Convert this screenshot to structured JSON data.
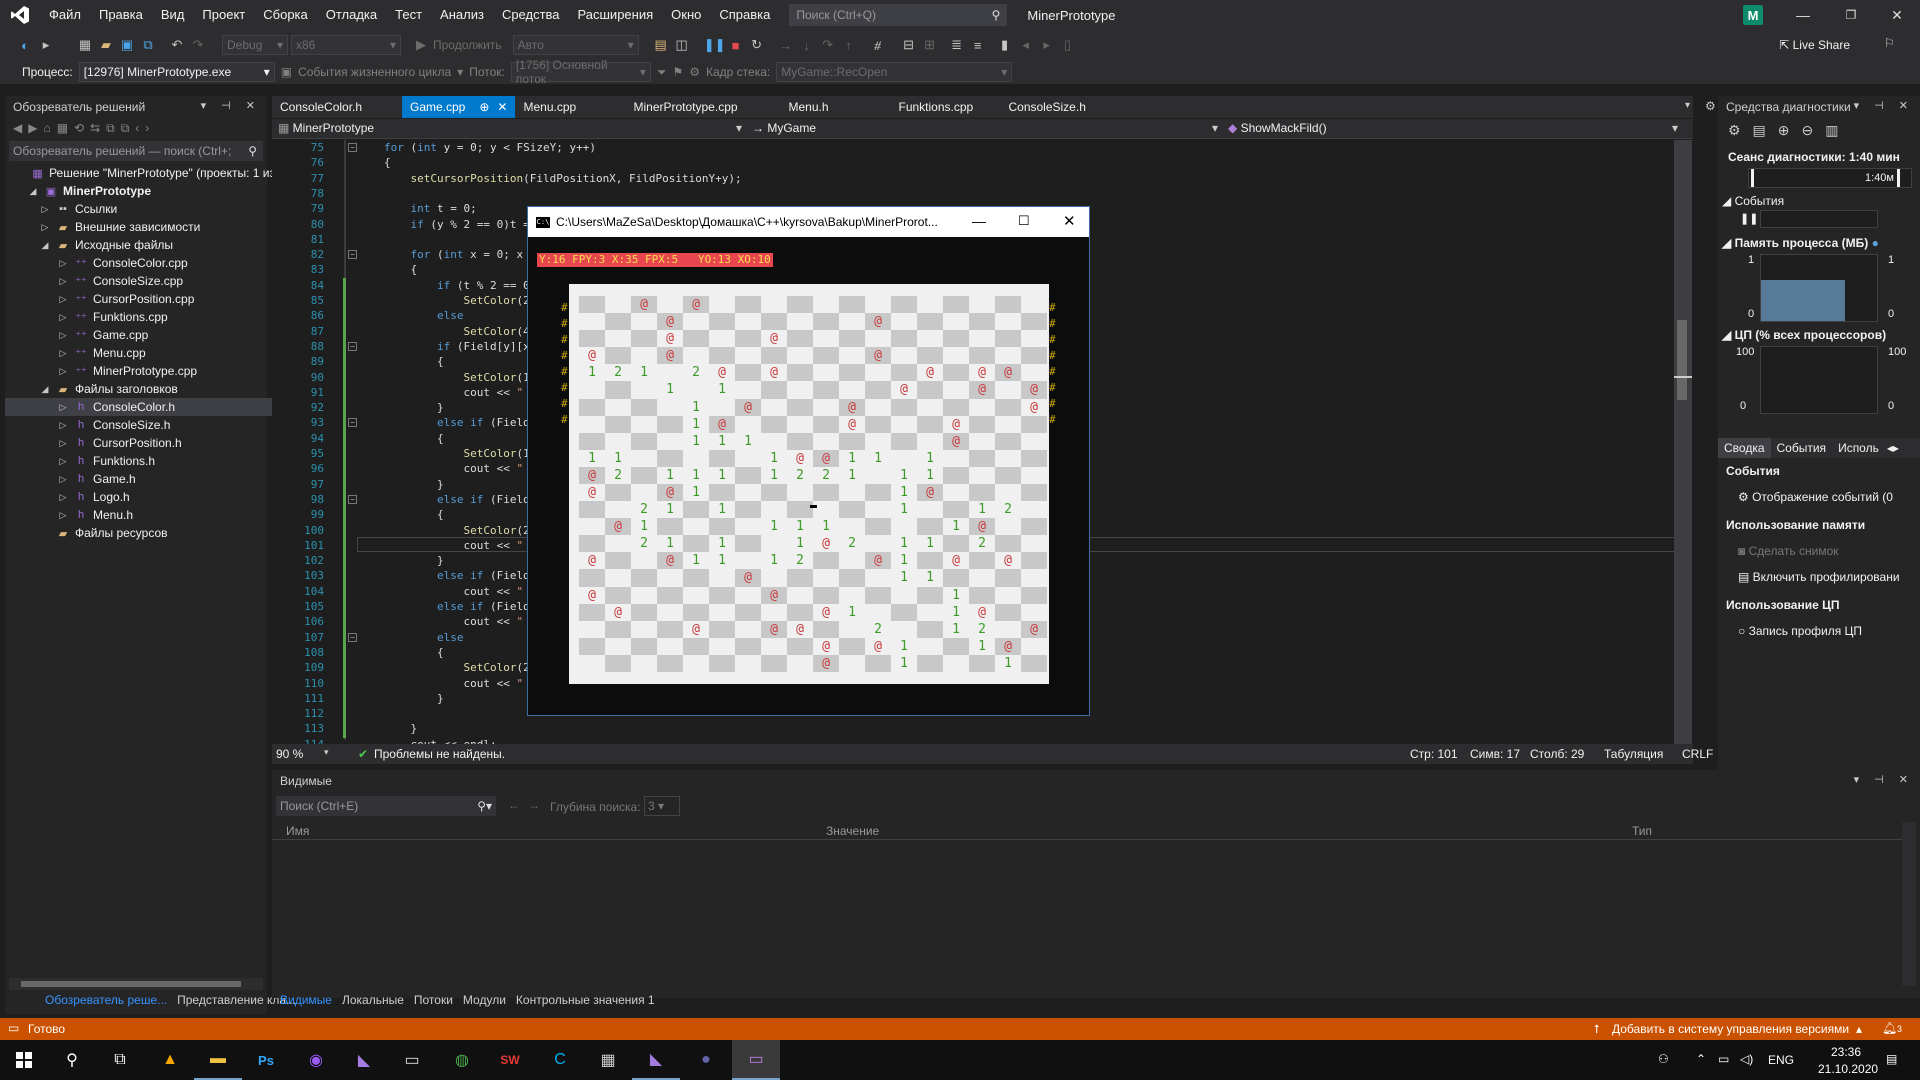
{
  "menubar": {
    "items": [
      "Файл",
      "Правка",
      "Вид",
      "Проект",
      "Сборка",
      "Отладка",
      "Тест",
      "Анализ",
      "Средства",
      "Расширения",
      "Окно",
      "Справка"
    ],
    "search_placeholder": "Поиск (Ctrl+Q)",
    "project_title": "MinerPrototype",
    "avatar_letter": "M"
  },
  "toolbar": {
    "config": "Debug",
    "platform": "x86",
    "continue_label": "Продолжить",
    "auto_label": "Авто",
    "live_share": "Live Share"
  },
  "toolbar2": {
    "process_label": "Процесс:",
    "process_value": "[12976] MinerPrototype.exe",
    "lifecycle_label": "События жизненного цикла",
    "thread_label": "Поток:",
    "thread_value": "[1756] Основной поток",
    "stack_label": "Кадр стека:",
    "stack_value": "MyGame::RecOpen"
  },
  "solution_explorer": {
    "title": "Обозреватель решений",
    "search_placeholder": "Обозреватель решений — поиск (Ctrl+;",
    "solution": "Решение \"MinerPrototype\" (проекты: 1 из",
    "project": "MinerPrototype",
    "refs": "Ссылки",
    "ext_deps": "Внешние зависимости",
    "src_folder": "Исходные файлы",
    "src_files": [
      "ConsoleColor.cpp",
      "ConsoleSize.cpp",
      "CursorPosition.cpp",
      "Funktions.cpp",
      "Game.cpp",
      "Menu.cpp",
      "MinerPrototype.cpp"
    ],
    "hdr_folder": "Файлы заголовков",
    "hdr_files": [
      "ConsoleColor.h",
      "ConsoleSize.h",
      "CursorPosition.h",
      "Funktions.h",
      "Game.h",
      "Logo.h",
      "Menu.h"
    ],
    "res_folder": "Файлы ресурсов",
    "bottom_tabs": [
      "Обозреватель реше...",
      "Представление кла..."
    ]
  },
  "doc_tabs": [
    "ConsoleColor.h",
    "Game.cpp",
    "Menu.cpp",
    "MinerPrototype.cpp",
    "Menu.h",
    "Funktions.cpp",
    "ConsoleSize.h"
  ],
  "nav_bar": {
    "project": "MinerPrototype",
    "scope": "MyGame",
    "member": "ShowMackFild()"
  },
  "code": [
    {
      "n": "75",
      "t": "for (int y = 0; y < FSizeY; y++)"
    },
    {
      "n": "76",
      "t": "{"
    },
    {
      "n": "77",
      "t": "    setCursorPosition(FildPositionX, FildPositionY+y);"
    },
    {
      "n": "78",
      "t": ""
    },
    {
      "n": "79",
      "t": "    int t = 0;"
    },
    {
      "n": "80",
      "t": "    if (y % 2 == 0)t ="
    },
    {
      "n": "81",
      "t": ""
    },
    {
      "n": "82",
      "t": "    for (int x = 0; x"
    },
    {
      "n": "83",
      "t": "    {"
    },
    {
      "n": "84",
      "t": "        if (t % 2 == 0"
    },
    {
      "n": "85",
      "t": "            SetColor(2,"
    },
    {
      "n": "86",
      "t": "        else"
    },
    {
      "n": "87",
      "t": "            SetColor(4,"
    },
    {
      "n": "88",
      "t": "        if (Field[y][x"
    },
    {
      "n": "89",
      "t": "        {"
    },
    {
      "n": "90",
      "t": "            SetColor(15"
    },
    {
      "n": "91",
      "t": "            cout << \""
    },
    {
      "n": "92",
      "t": "        }"
    },
    {
      "n": "93",
      "t": "        else if (Field["
    },
    {
      "n": "94",
      "t": "        {"
    },
    {
      "n": "95",
      "t": "            SetColor(15"
    },
    {
      "n": "96",
      "t": "            cout << \""
    },
    {
      "n": "97",
      "t": "        }"
    },
    {
      "n": "98",
      "t": "        else if (Field["
    },
    {
      "n": "99",
      "t": "        {"
    },
    {
      "n": "100",
      "t": "            SetColor(2,"
    },
    {
      "n": "101",
      "t": "            cout << \""
    },
    {
      "n": "102",
      "t": "        }"
    },
    {
      "n": "103",
      "t": "        else if (Field["
    },
    {
      "n": "104",
      "t": "            cout << \""
    },
    {
      "n": "105",
      "t": "        else if (Field["
    },
    {
      "n": "106",
      "t": "            cout << \" @"
    },
    {
      "n": "107",
      "t": "        else"
    },
    {
      "n": "108",
      "t": "        {"
    },
    {
      "n": "109",
      "t": "            SetColor(2,"
    },
    {
      "n": "110",
      "t": "            cout << \""
    },
    {
      "n": "111",
      "t": "        }"
    },
    {
      "n": "112",
      "t": ""
    },
    {
      "n": "113",
      "t": "    }"
    },
    {
      "n": "114",
      "t": "    cout << endl;"
    }
  ],
  "editor_status": {
    "zoom": "90 %",
    "problems": "Проблемы не найдены.",
    "line": "Стр: 101",
    "char": "Симв: 17",
    "col": "Столб: 29",
    "tabs": "Табуляция",
    "eol": "CRLF"
  },
  "console": {
    "title": "C:\\Users\\MaZeSa\\Desktop\\Домашка\\C++\\kyrsova\\Bakup\\MinerProrot...",
    "status": "Y:16 FPY:3 X:35 FPX:5   YO:13 XO:10"
  },
  "board_rows": [
    " .@.@.  .  . . .  ",
    "   @   .  .@.  .  ",
    " . @  .@.  .  .  .",
    "@ .@.  .  .@. . . ",
    "121 2@ @. . .@ @@ ",
    "   1 1 . .  @ .@ @",
    "    1 @. .@.  .  @",
    "    1@ . .@.  @.  ",
    "    111 .  .  @   ",
    "11     1@@11 1    ",
    "@2 111 1221 11    ",
    "@  @1    .  1@    ",
    "  21 1      1  12 ",
    " @1    111    1@  ",
    "  21 1  1@2 11 2  ",
    "@  @11 12  @1 @ @ ",
    "      @     11    ",
    "@      @      1   ",
    " @       @1   1@  ",
    "    @  @@  2  12 @",
    "         @ @1  1@ ",
    "         @  1   1 "
  ],
  "diagnostics": {
    "title": "Средства диагностики",
    "session": "Сеанс диагностики: 1:40 мин",
    "timeline_label": "1:40м",
    "events_header": "События",
    "memory_header": "Память процесса (МБ)",
    "mem_max": "1",
    "mem_min": "0",
    "cpu_header": "ЦП (% всех процессоров)",
    "cpu_max": "100",
    "cpu_min": "0",
    "tabs": [
      "Сводка",
      "События",
      "Исполь"
    ],
    "sec_events": "События",
    "show_events": "Отображение событий (0",
    "sec_memory": "Использование памяти",
    "snapshot": "Сделать снимок",
    "heap_profiling": "Включить профилировани",
    "sec_cpu": "Использование ЦП",
    "cpu_profile": "Запись профиля ЦП",
    "memory_fill": 0.75
  },
  "watch": {
    "title": "Видимые",
    "search_placeholder": "Поиск (Ctrl+E)",
    "depth_label": "Глубина поиска:",
    "depth_value": "3",
    "col_name": "Имя",
    "col_value": "Значение",
    "col_type": "Тип",
    "tabs": [
      "Видимые",
      "Локальные",
      "Потоки",
      "Модули",
      "Контрольные значения 1"
    ]
  },
  "statusbar": {
    "ready": "Готово",
    "vcs": "Добавить в систему управления версиями",
    "notif_count": "3"
  },
  "taskbar": {
    "lang": "ENG",
    "time": "23:36",
    "date": "21.10.2020"
  },
  "colors": {
    "accent": "#007acc",
    "status_orange": "#ca5100",
    "mine_red": "#c8383c",
    "num_green": "#3c9b27"
  }
}
